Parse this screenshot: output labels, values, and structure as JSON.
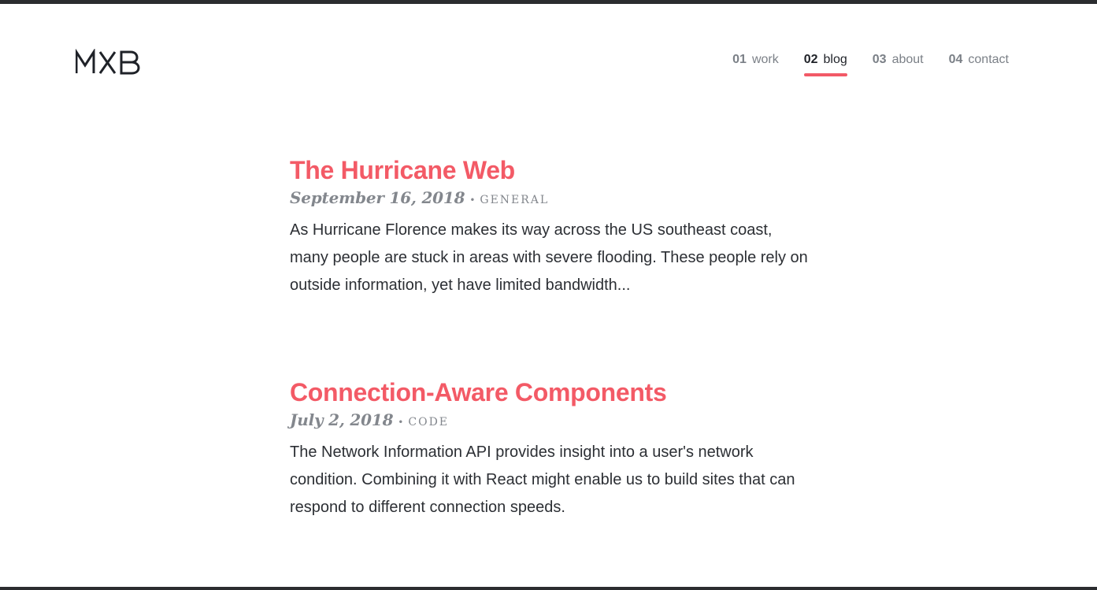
{
  "brand": {
    "logo_text": "MXB",
    "accent_color": "#f35a66"
  },
  "nav": {
    "items": [
      {
        "number": "01",
        "label": "work",
        "active": false
      },
      {
        "number": "02",
        "label": "blog",
        "active": true
      },
      {
        "number": "03",
        "label": "about",
        "active": false
      },
      {
        "number": "04",
        "label": "contact",
        "active": false
      }
    ]
  },
  "posts": [
    {
      "title": "The Hurricane Web",
      "date": "September 16, 2018",
      "separator": "•",
      "category": "GENERAL",
      "excerpt": "As Hurricane Florence makes its way across the US southeast coast, many people are stuck in areas with severe flooding. These people rely on outside information, yet have limited bandwidth..."
    },
    {
      "title": "Connection-Aware Components",
      "date": "July 2, 2018",
      "separator": "•",
      "category": "CODE",
      "excerpt": "The Network Information API provides insight into a user's network condition. Combining it with React might enable us to build sites that can respond to different connection speeds."
    }
  ]
}
